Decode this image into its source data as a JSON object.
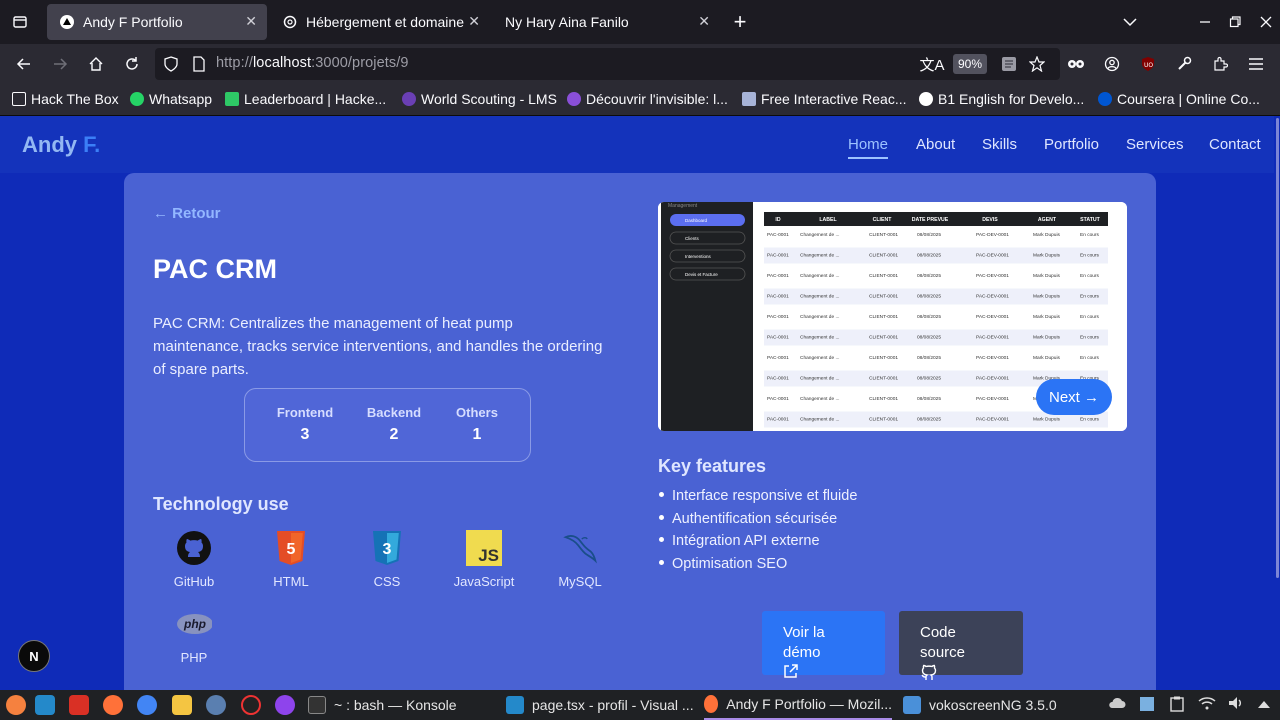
{
  "browser": {
    "tabs": [
      {
        "label": "Andy F Portfolio",
        "active": true
      },
      {
        "label": "Hébergement et domaine",
        "active": false
      },
      {
        "label": "Ny Hary Aina Fanilo",
        "active": false
      }
    ],
    "url_prefix": "http://",
    "url_host": "localhost",
    "url_path": ":3000/projets/9",
    "zoom": "90%",
    "bookmarks": [
      {
        "label": "Hack The Box",
        "color": "#9fef00"
      },
      {
        "label": "Whatsapp",
        "color": "#25d366"
      },
      {
        "label": "Leaderboard | Hacke...",
        "color": "#2ec866"
      },
      {
        "label": "World Scouting - LMS",
        "color": "#6a3fb5"
      },
      {
        "label": "Découvrir l'invisible: l...",
        "color": "#8a4fd8"
      },
      {
        "label": "Free Interactive Reac...",
        "color": "#a7b3d8"
      },
      {
        "label": "B1 English for Develo...",
        "color": "#222"
      },
      {
        "label": "Coursera | Online Co...",
        "color": "#0056d2"
      }
    ]
  },
  "site": {
    "logo_main": "Andy",
    "logo_accent": "F.",
    "nav": [
      "Home",
      "About",
      "Skills",
      "Portfolio",
      "Services",
      "Contact"
    ],
    "back": "← Retour",
    "title": "PAC CRM",
    "description": "PAC CRM: Centralizes the management of heat pump maintenance, tracks service interventions, and handles the ordering of spare parts.",
    "stats": [
      {
        "label": "Frontend",
        "value": "3"
      },
      {
        "label": "Backend",
        "value": "2"
      },
      {
        "label": "Others",
        "value": "1"
      }
    ],
    "tech_title": "Technology use",
    "tech": [
      {
        "label": "GitHub",
        "icon": "github-icon"
      },
      {
        "label": "HTML",
        "icon": "html5-icon"
      },
      {
        "label": "CSS",
        "icon": "css3-icon"
      },
      {
        "label": "JavaScript",
        "icon": "javascript-icon"
      },
      {
        "label": "MySQL",
        "icon": "mysql-icon"
      },
      {
        "label": "PHP",
        "icon": "php-icon"
      }
    ],
    "next": "Next →",
    "kf_title": "Key features",
    "features": [
      "Interface responsive et fluide",
      "Authentification sécurisée",
      "Intégration API externe",
      "Optimisation SEO"
    ],
    "demo": "Voir la démo",
    "source": "Code source",
    "next_badge": "N",
    "screenshot": {
      "sidebar": [
        "Dashboard",
        "Clients",
        "Interventions",
        "Devis et Facture"
      ],
      "columns": [
        "ID",
        "LABEL",
        "CLIENT",
        "DATE PREVUE",
        "DEVIS",
        "AGENT",
        "STATUT"
      ],
      "row": [
        "PAC-0001",
        "Changement de ...",
        "CLIENT-0001",
        "08/08/2025",
        "PAC-DEV-0001",
        "Mark Dupuis",
        "En cours"
      ]
    }
  },
  "taskbar": {
    "tasks": [
      {
        "label": "~ : bash — Konsole",
        "color": "#333"
      },
      {
        "label": "page.tsx - profil - Visual ...",
        "color": "#2489ca"
      },
      {
        "label": "Andy F Portfolio — Mozil...",
        "color": "#ff7139"
      },
      {
        "label": "vokoscreenNG 3.5.0",
        "color": "#4a90d9"
      }
    ]
  }
}
